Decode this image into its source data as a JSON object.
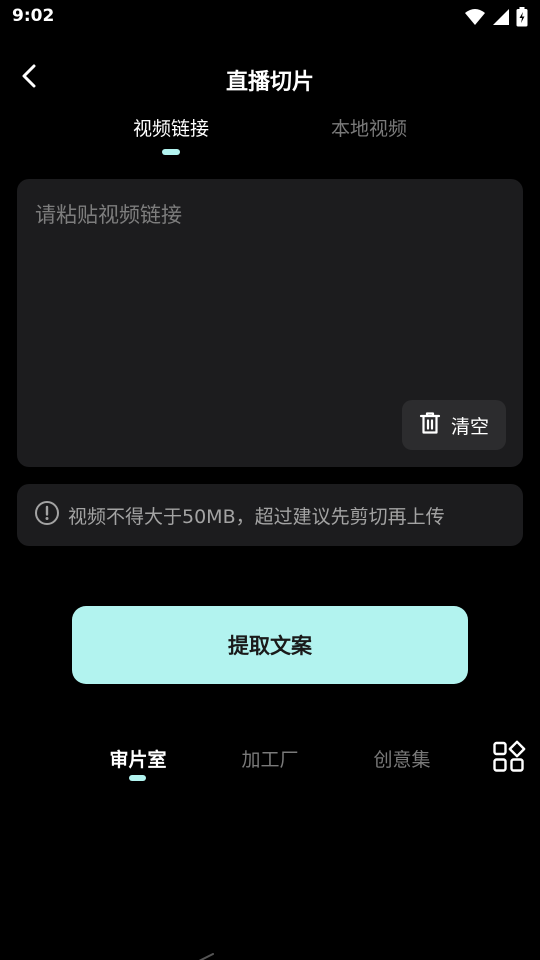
{
  "status_bar": {
    "time": "9:02"
  },
  "header": {
    "title": "直播切片"
  },
  "top_tabs": [
    {
      "label": "视频链接",
      "active": true
    },
    {
      "label": "本地视频",
      "active": false
    }
  ],
  "input": {
    "placeholder": "请粘贴视频链接",
    "value": ""
  },
  "clear_button": {
    "label": "清空"
  },
  "notice": {
    "text": "视频不得大于50MB，超过建议先剪切再上传"
  },
  "extract_button": {
    "label": "提取文案"
  },
  "bottom_tabs": [
    {
      "label": "审片室",
      "active": true
    },
    {
      "label": "加工厂",
      "active": false
    },
    {
      "label": "创意集",
      "active": false
    }
  ],
  "colors": {
    "accent": "#b2f3ef",
    "background": "#000000",
    "card": "#1c1c1e",
    "muted_text": "#7a7a7a"
  },
  "icons": [
    "back-arrow-icon",
    "trash-icon",
    "info-icon",
    "grid-apps-icon",
    "wifi-icon",
    "signal-icon",
    "battery-icon"
  ]
}
